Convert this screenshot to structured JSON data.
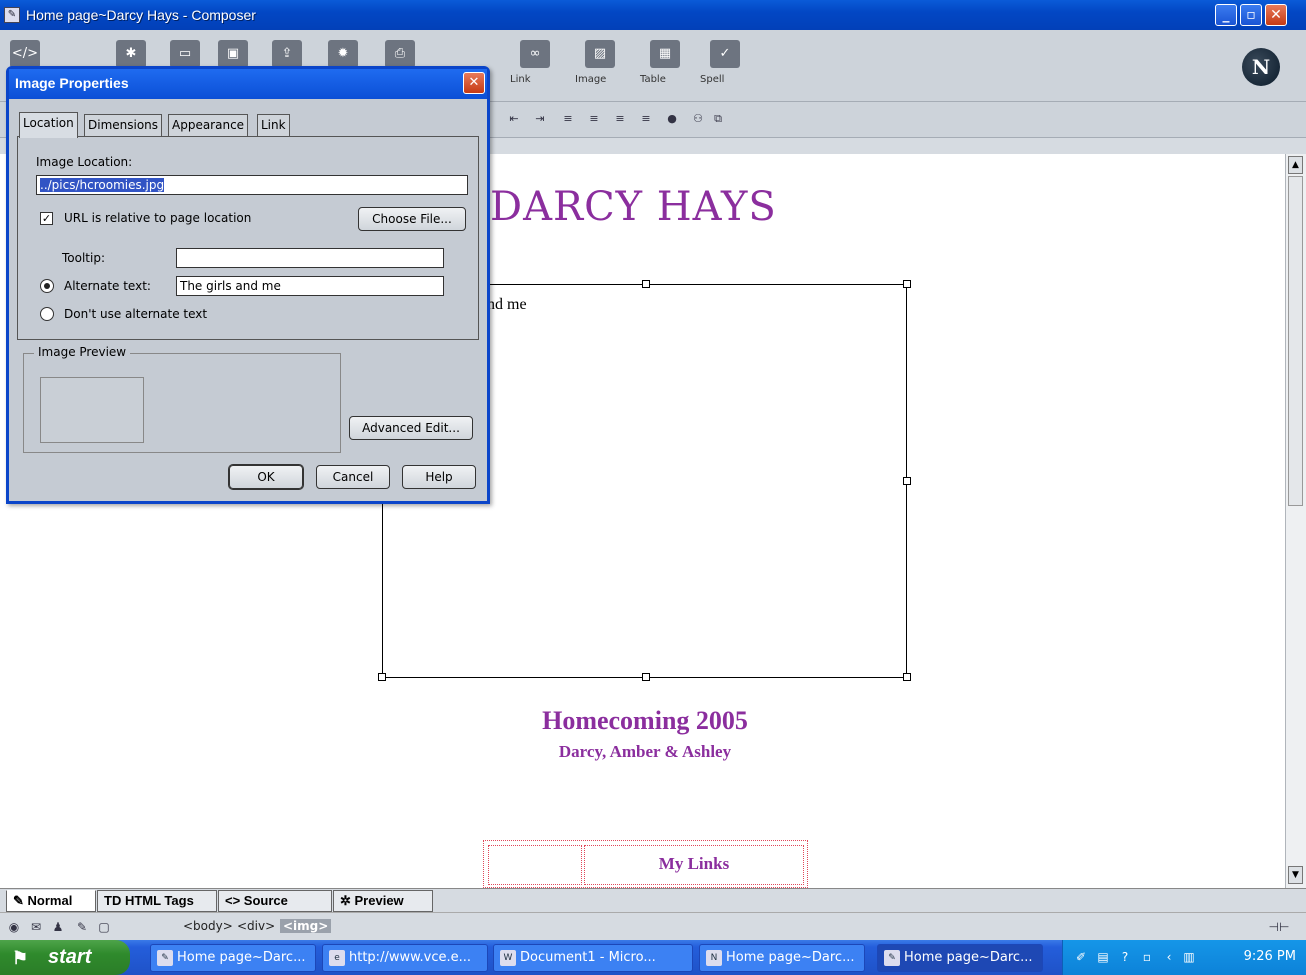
{
  "window": {
    "title": "Home page~Darcy Hays - Composer",
    "controls": [
      "_",
      "▫",
      "✕"
    ]
  },
  "toolbar": {
    "items": [
      {
        "label": "",
        "icon": "html-icon"
      },
      {
        "label": "",
        "icon": "new-icon"
      },
      {
        "label": "",
        "icon": "open-icon"
      },
      {
        "label": "",
        "icon": "save-icon"
      },
      {
        "label": "",
        "icon": "publish-icon"
      },
      {
        "label": "",
        "icon": "browse-icon"
      },
      {
        "label": "",
        "icon": "print-icon"
      },
      {
        "label": "Link",
        "icon": "link-icon"
      },
      {
        "label": "Image",
        "icon": "image-icon"
      },
      {
        "label": "Table",
        "icon": "table-icon"
      },
      {
        "label": "Spell",
        "icon": "spell-icon"
      }
    ],
    "logo": "N"
  },
  "document": {
    "heading": "DARCY HAYS",
    "image_alt_fragment": "nd me",
    "caption_title": "Homecoming 2005",
    "caption_sub": "Darcy, Amber & Ashley",
    "links_label": "My Links"
  },
  "mode_tabs": [
    "Normal",
    "HTML Tags",
    "Source",
    "Preview"
  ],
  "status": {
    "crumbs": [
      "<body>",
      "<div>",
      "<img>"
    ]
  },
  "taskbar": {
    "start": "start",
    "buttons": [
      "Home page~Darc...",
      "http://www.vce.e...",
      "Document1 - Micro...",
      "Home page~Darc...",
      "Home page~Darc..."
    ],
    "clock": "9:26 PM"
  },
  "dialog": {
    "title": "Image Properties",
    "tabs": [
      "Location",
      "Dimensions",
      "Appearance",
      "Link"
    ],
    "image_location_label": "Image Location:",
    "image_location_value": "../pics/hcroomies.jpg",
    "relative_label": "URL is relative to page location",
    "relative_checked": true,
    "choose_file": "Choose File...",
    "tooltip_label": "Tooltip:",
    "tooltip_value": "",
    "alt_label": "Alternate text:",
    "alt_value": "The girls and me",
    "no_alt_label": "Don't use alternate text",
    "preview_legend": "Image Preview",
    "advanced_edit": "Advanced Edit...",
    "ok": "OK",
    "cancel": "Cancel",
    "help": "Help"
  }
}
